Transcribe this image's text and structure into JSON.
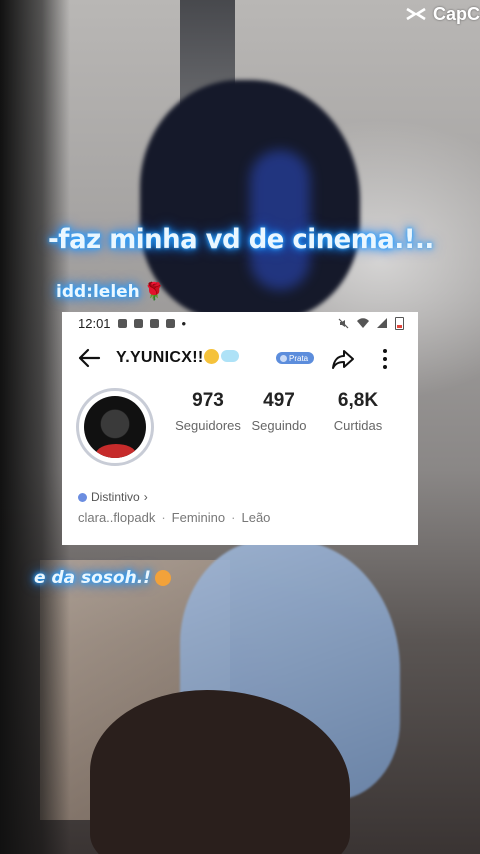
{
  "watermark": {
    "text": "CapC",
    "icon": "capcut-logo-icon"
  },
  "overlay": {
    "caption_main": "-faz minha vd de cinema.!..",
    "caption_idd": "idd:leleh",
    "caption_sosoh": "e da sosoh.!",
    "emoji_rose": "🌹",
    "emoji_shrug": "shrug-emoji"
  },
  "phone": {
    "status_bar": {
      "time": "12:01",
      "dot": "•"
    },
    "profile": {
      "username": "Y.YUNICX!!",
      "badge": "Prata",
      "stats": [
        {
          "value": "973",
          "label": "Seguidores"
        },
        {
          "value": "497",
          "label": "Seguindo"
        },
        {
          "value": "6,8K",
          "label": "Curtidas"
        }
      ],
      "distintivo": "Distintivo",
      "distintivo_chevron": "›",
      "bio": [
        "clara..flopadk",
        "Feminino",
        "Leão"
      ],
      "bio_sep": "·"
    }
  },
  "colors": {
    "glow": "#2aa2ff",
    "badge": "#5c8ddc"
  }
}
